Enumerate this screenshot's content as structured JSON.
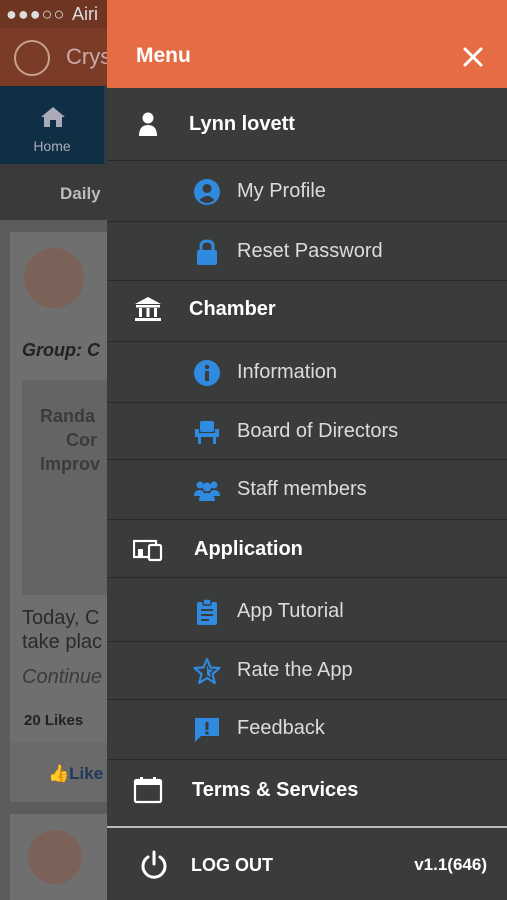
{
  "status_bar": {
    "carrier": "Airi"
  },
  "background_app": {
    "app_name": "Crys",
    "home_tab_label": "Home",
    "daily_tab_label": "Daily",
    "group_label": "Group: C",
    "post_image_text": [
      "Randa",
      "Cor",
      "Improv"
    ],
    "post_text_line1": "Today, C",
    "post_text_line2": "take plac",
    "continue_text": "Continue",
    "likes_text": "20 Likes",
    "like_button_label": "Like"
  },
  "drawer": {
    "title": "Menu",
    "close_icon": "close-icon",
    "user": {
      "name": "Lynn lovett",
      "icon": "user-icon"
    },
    "user_items": [
      {
        "label": "My Profile",
        "icon": "profile-icon"
      },
      {
        "label": "Reset Password",
        "icon": "lock-icon"
      }
    ],
    "chamber": {
      "label": "Chamber",
      "icon": "bank-icon"
    },
    "chamber_items": [
      {
        "label": "Information",
        "icon": "info-icon"
      },
      {
        "label": "Board of Directors",
        "icon": "chair-icon"
      },
      {
        "label": "Staff members",
        "icon": "group-icon"
      }
    ],
    "application": {
      "label": "Application",
      "icon": "devices-icon"
    },
    "application_items": [
      {
        "label": "App Tutorial",
        "icon": "clipboard-icon"
      },
      {
        "label": "Rate the App",
        "icon": "star-icon"
      },
      {
        "label": "Feedback",
        "icon": "feedback-icon"
      }
    ],
    "terms": {
      "label": "Terms & Services",
      "icon": "calendar-icon"
    },
    "logout": {
      "label": "LOG OUT",
      "icon": "power-icon"
    },
    "version": "v1.1(646)"
  },
  "colors": {
    "header_bg": "#e56c44",
    "drawer_bg": "#3a3b3b",
    "sub_icon_blue": "#2f8ae0",
    "text_white": "#ffffff"
  }
}
